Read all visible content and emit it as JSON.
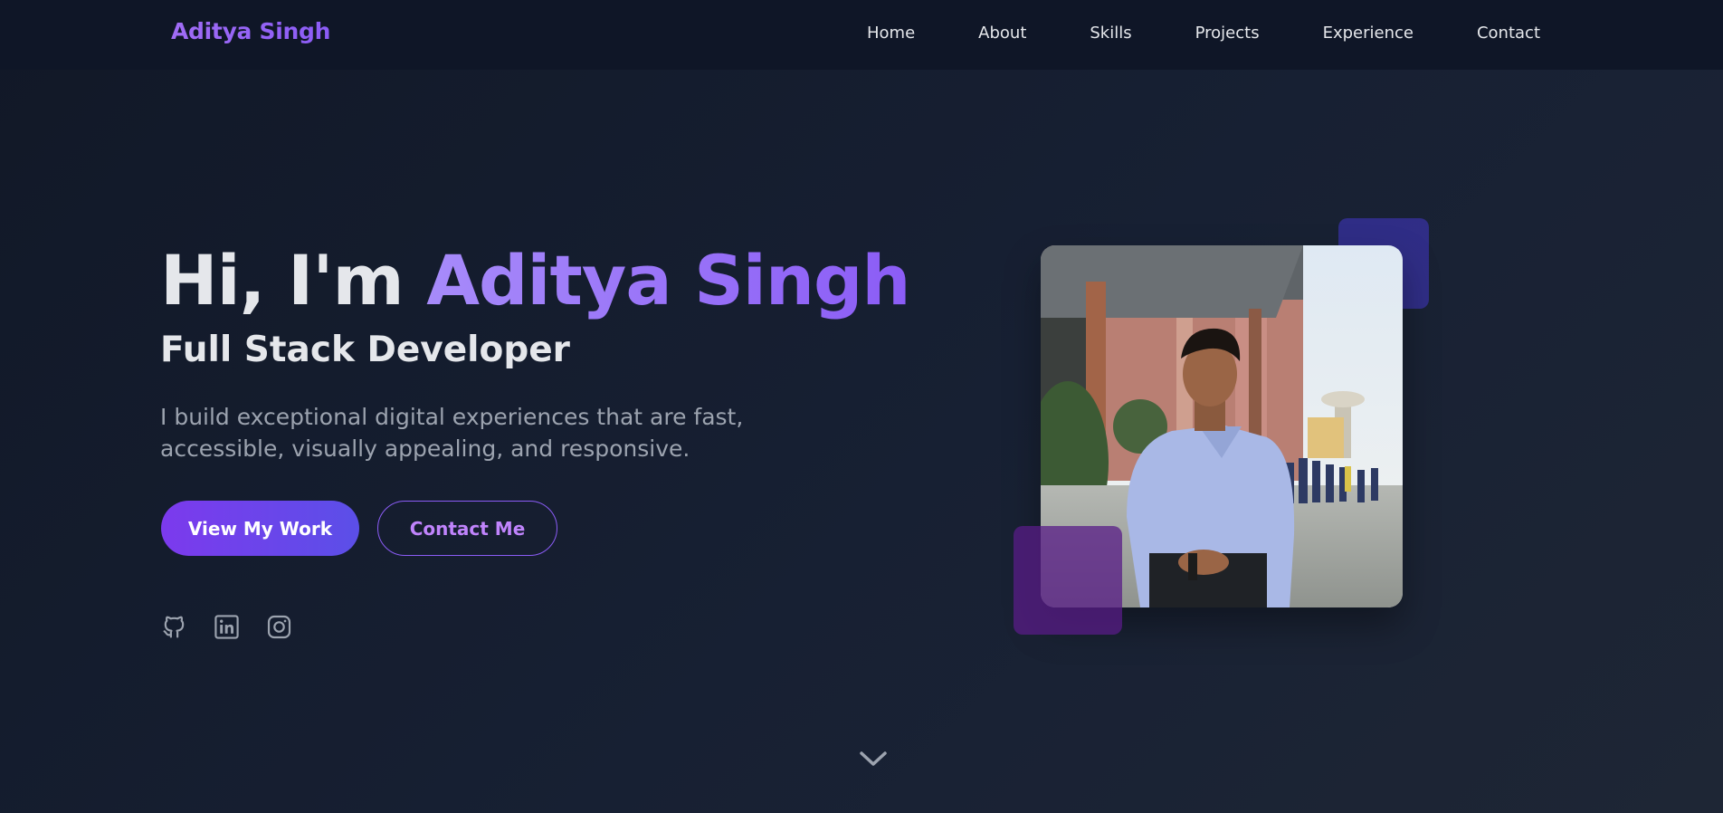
{
  "nav": {
    "logo": "Aditya Singh",
    "links": [
      "Home",
      "About",
      "Skills",
      "Projects",
      "Experience",
      "Contact"
    ]
  },
  "hero": {
    "greeting": "Hi, I'm ",
    "name": "Aditya Singh",
    "role": "Full Stack Developer",
    "description": "I build exceptional digital experiences that are fast, accessible, visually appealing, and responsive.",
    "primary_button": "View My Work",
    "secondary_button": "Contact Me"
  },
  "socials": [
    "github-icon",
    "linkedin-icon",
    "instagram-icon"
  ],
  "colors": {
    "accent": "#8b5cf6",
    "background": "#151b2b",
    "nav_background": "#0f1627",
    "text": "#e5e7eb",
    "muted": "#9ca3af"
  }
}
